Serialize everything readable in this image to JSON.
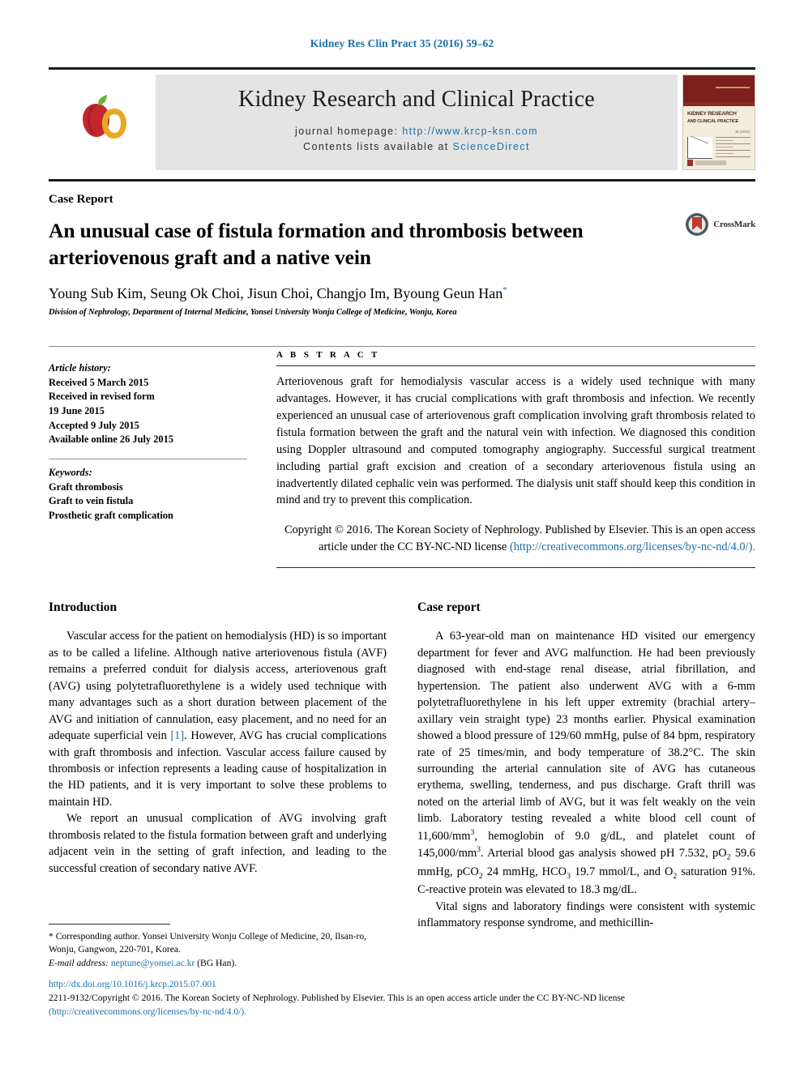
{
  "running_head": "Kidney Res Clin Pract 35 (2016) 59–62",
  "colors": {
    "link": "#1a6fa8",
    "masthead_band": "#e4e4e4",
    "rule": "#1a1a1a",
    "cover_maroon": "#7d1f1c"
  },
  "masthead": {
    "journal_title": "Kidney Research and Clinical Practice",
    "homepage_label": "journal homepage:",
    "homepage_url": "http://www.krcp-ksn.com",
    "contents_label": "Contents lists available at",
    "contents_source": "ScienceDirect",
    "cover": {
      "title_line1": "KIDNEY RESEARCH",
      "title_line2": "AND CLINICAL PRACTICE",
      "issue": "35 (2016)"
    }
  },
  "article": {
    "kicker": "Case Report",
    "title": "An unusual case of fistula formation and thrombosis between arteriovenous graft and a native vein",
    "authors": "Young Sub Kim, Seung Ok Choi, Jisun Choi, Changjo Im, Byoung Geun Han",
    "author_marker": "*",
    "affiliation": "Division of Nephrology, Department of Internal Medicine, Yonsei University Wonju College of Medicine, Wonju, Korea",
    "crossmark_label": "CrossMark"
  },
  "meta": {
    "history_head": "Article history:",
    "history": [
      "Received 5 March 2015",
      "Received in revised form",
      "19 June 2015",
      "Accepted 9 July 2015",
      "Available online 26 July 2015"
    ],
    "keywords_head": "Keywords:",
    "keywords": [
      "Graft thrombosis",
      "Graft to vein fistula",
      "Prosthetic graft complication"
    ]
  },
  "abstract": {
    "heading": "A B S T R A C T",
    "text": "Arteriovenous graft for hemodialysis vascular access is a widely used technique with many advantages. However, it has crucial complications with graft thrombosis and infection. We recently experienced an unusual case of arteriovenous graft complication involving graft thrombosis related to fistula formation between the graft and the natural vein with infection. We diagnosed this condition using Doppler ultrasound and computed tomography angiography. Successful surgical treatment including partial graft excision and creation of a secondary arteriovenous fistula using an inadvertently dilated cephalic vein was performed. The dialysis unit staff should keep this condition in mind and try to prevent this complication.",
    "copyright_text": "Copyright © 2016. The Korean Society of Nephrology. Published by Elsevier. This is an open access article under the CC BY-NC-ND license",
    "copyright_link": "(http://creativecommons.org/licenses/by-nc-nd/4.0/)."
  },
  "body": {
    "left": {
      "heading": "Introduction",
      "p1_a": "Vascular access for the patient on hemodialysis (HD) is so important as to be called a lifeline. Although native arteriovenous fistula (AVF) remains a preferred conduit for dialysis access, arteriovenous graft (AVG) using polytetrafluorethylene is a widely used technique with many advantages such as a short duration between placement of the AVG and initiation of cannulation, easy placement, and no need for an adequate superficial vein ",
      "p1_ref": "[1]",
      "p1_b": ". However, AVG has crucial complications with graft thrombosis and infection. Vascular access failure caused by thrombosis or infection represents a leading cause of hospitalization in the HD patients, and it is very important to solve these problems to maintain HD.",
      "p2": "We report an unusual complication of AVG involving graft thrombosis related to the fistula formation between graft and underlying adjacent vein in the setting of graft infection, and leading to the successful creation of secondary native AVF."
    },
    "right": {
      "heading": "Case report",
      "p1_a": "A 63-year-old man on maintenance HD visited our emergency department for fever and AVG malfunction. He had been previously diagnosed with end-stage renal disease, atrial fibrillation, and hypertension. The patient also underwent AVG with a 6-mm polytetrafluorethylene in his left upper extremity (brachial artery–axillary vein straight type) 23 months earlier. Physical examination showed a blood pressure of 129/60 mmHg, pulse of 84 bpm, respiratory rate of 25 times/min, and body temperature of 38.2°C. The skin surrounding the arterial cannulation site of AVG has cutaneous erythema, swelling, tenderness, and pus discharge. Graft thrill was noted on the arterial limb of AVG, but it was felt weakly on the vein limb. Laboratory testing revealed a white blood cell count of 11,600/mm",
      "p1_sup1": "3",
      "p1_b": ", hemoglobin of 9.0 g/dL, and platelet count of 145,000/mm",
      "p1_sup2": "3",
      "p1_c": ". Arterial blood gas analysis showed pH 7.532, pO",
      "p1_sub1": "2",
      "p1_d": " 59.6 mmHg, pCO",
      "p1_sub2": "2",
      "p1_e": " 24 mmHg, HCO",
      "p1_sub3": "3",
      "p1_f": " 19.7 mmol/L, and O",
      "p1_sub4": "2",
      "p1_g": " saturation 91%. C-reactive protein was elevated to 18.3 mg/dL.",
      "p2": "Vital signs and laboratory findings were consistent with systemic inflammatory response syndrome, and methicillin-"
    }
  },
  "footnote": {
    "marker": "*",
    "corresponding": " Corresponding author. Yonsei University Wonju College of Medicine, 20, Ilsan-ro, Wonju, Gangwon, 220-701, Korea.",
    "email_label": "E-mail address:",
    "email": "neptune@yonsei.ac.kr",
    "email_suffix": " (BG Han)."
  },
  "page_footer": {
    "doi": "http://dx.doi.org/10.1016/j.krcp.2015.07.001",
    "issn_line": "2211-9132/Copyright © 2016. The Korean Society of Nephrology. Published by Elsevier. This is an open access article under the CC BY-NC-ND license",
    "license_link": "(http://creativecommons.org/licenses/by-nc-nd/4.0/)."
  }
}
